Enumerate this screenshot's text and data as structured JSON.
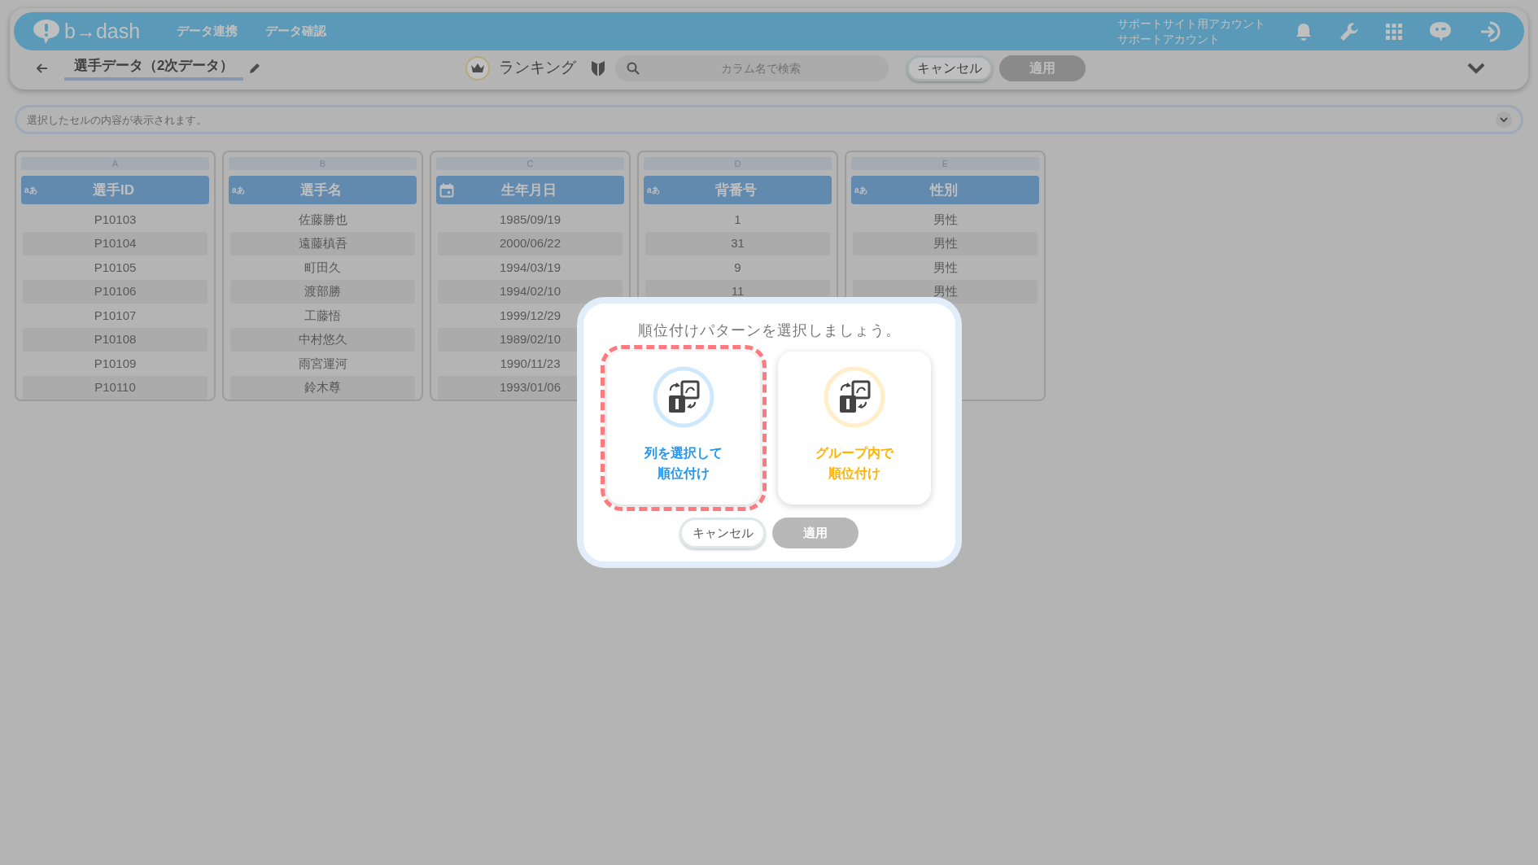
{
  "header": {
    "logo": "b→dash",
    "nav": [
      "データ連携",
      "データ確認"
    ],
    "account": [
      "サポートサイト用アカウント",
      "サポートアカウント"
    ]
  },
  "toolbar": {
    "title": "選手データ（2次データ）",
    "mode": "ランキング",
    "search": {
      "placeholder": "カラム名で検索"
    },
    "buttons": [
      {
        "label": "キャンセル",
        "kind": "outline"
      },
      {
        "label": "適用",
        "kind": "disabled"
      }
    ]
  },
  "cell_viewer": {
    "placeholder": "選択したセルの内容が表示されます。"
  },
  "columns": [
    {
      "letter": "A",
      "kind": "text",
      "type_label": "aあ",
      "header": "選手ID",
      "cells": [
        "P10103",
        "P10104",
        "P10105",
        "P10106",
        "P10107",
        "P10108",
        "P10109",
        "P10110"
      ]
    },
    {
      "letter": "B",
      "kind": "text",
      "type_label": "aあ",
      "header": "選手名",
      "cells": [
        "佐藤勝也",
        "遠藤槙吾",
        "町田久",
        "渡部勝",
        "工藤悟",
        "中村悠久",
        "雨宮運河",
        "鈴木尊"
      ]
    },
    {
      "letter": "C",
      "kind": "date",
      "header": "生年月日",
      "cells": [
        "1985/09/19",
        "2000/06/22",
        "1994/03/19",
        "1994/02/10",
        "1999/12/29",
        "1989/02/10",
        "1990/11/23",
        "1993/01/06"
      ]
    },
    {
      "letter": "D",
      "kind": "text",
      "type_label": "aあ",
      "header": "背番号",
      "cells": [
        "1",
        "31",
        "9",
        "11"
      ]
    },
    {
      "letter": "E",
      "kind": "text",
      "type_label": "aあ",
      "header": "性別",
      "cells": [
        "男性",
        "男性",
        "男性",
        "男性"
      ]
    }
  ],
  "dialog": {
    "title": "順位付けパターンを選択しましょう。",
    "options": [
      {
        "label": [
          "列を選択して",
          "順位付け"
        ],
        "color": "#2196f3",
        "selected": true
      },
      {
        "label": [
          "グループ内で",
          "順位付け"
        ],
        "color": "#ffb300",
        "selected": false
      }
    ],
    "buttons": [
      {
        "label": "キャンセル",
        "kind": "outline"
      },
      {
        "label": "適用",
        "kind": "disabled"
      }
    ]
  }
}
